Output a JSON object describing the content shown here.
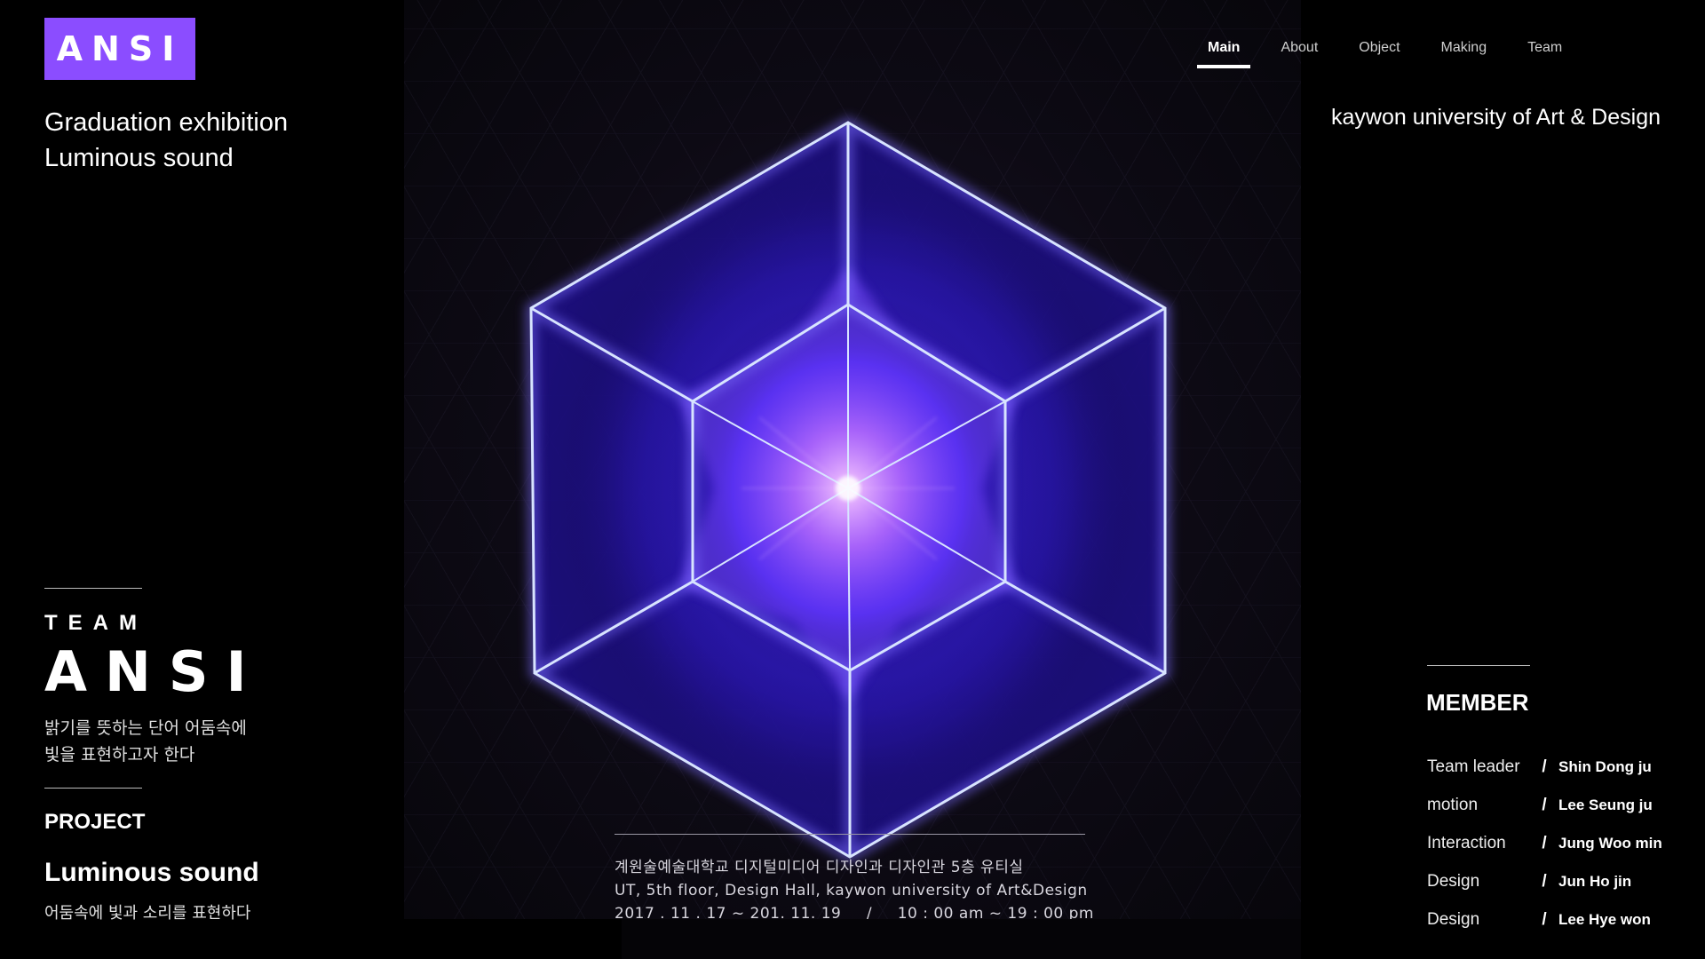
{
  "brand": {
    "logo": "ANSI",
    "accent": "#8b4dff"
  },
  "exhibition": {
    "line1": "Graduation exhibition",
    "line2": "Luminous sound"
  },
  "nav": {
    "items": [
      {
        "label": "Main",
        "active": true
      },
      {
        "label": "About",
        "active": false
      },
      {
        "label": "Object",
        "active": false
      },
      {
        "label": "Making",
        "active": false
      },
      {
        "label": "Team",
        "active": false
      }
    ]
  },
  "university": "kaywon university of Art & Design",
  "team": {
    "label": "TEAM",
    "logo": "ANSI",
    "desc_line1": "밝기를 뜻하는 단어 어둠속에",
    "desc_line2": "빛을 표현하고자 한다"
  },
  "project": {
    "label": "PROJECT",
    "name": "Luminous sound",
    "desc": "어둠속에 빛과 소리를 표현하다"
  },
  "poster": {
    "info_ko": "계원술예술대학교 디지털미디어 디자인과 디자인관 5층 유티실",
    "info_en": "UT, 5th floor, Design Hall, kaywon university of Art&Design",
    "dates": "2017 . 11 . 17 ~ 201. 11. 19",
    "sep": "/",
    "time": "10 : 00 am ~ 19 : 00 pm"
  },
  "members": {
    "title": "MEMBER",
    "list": [
      {
        "role": "Team leader",
        "sep": "/",
        "name": "Shin Dong ju"
      },
      {
        "role": "motion",
        "sep": "/",
        "name": "Lee Seung ju"
      },
      {
        "role": "Interaction",
        "sep": "/",
        "name": "Jung Woo min"
      },
      {
        "role": "Design",
        "sep": "/",
        "name": "Jun Ho jin"
      },
      {
        "role": "Design",
        "sep": "/",
        "name": "Lee Hye won"
      }
    ]
  }
}
